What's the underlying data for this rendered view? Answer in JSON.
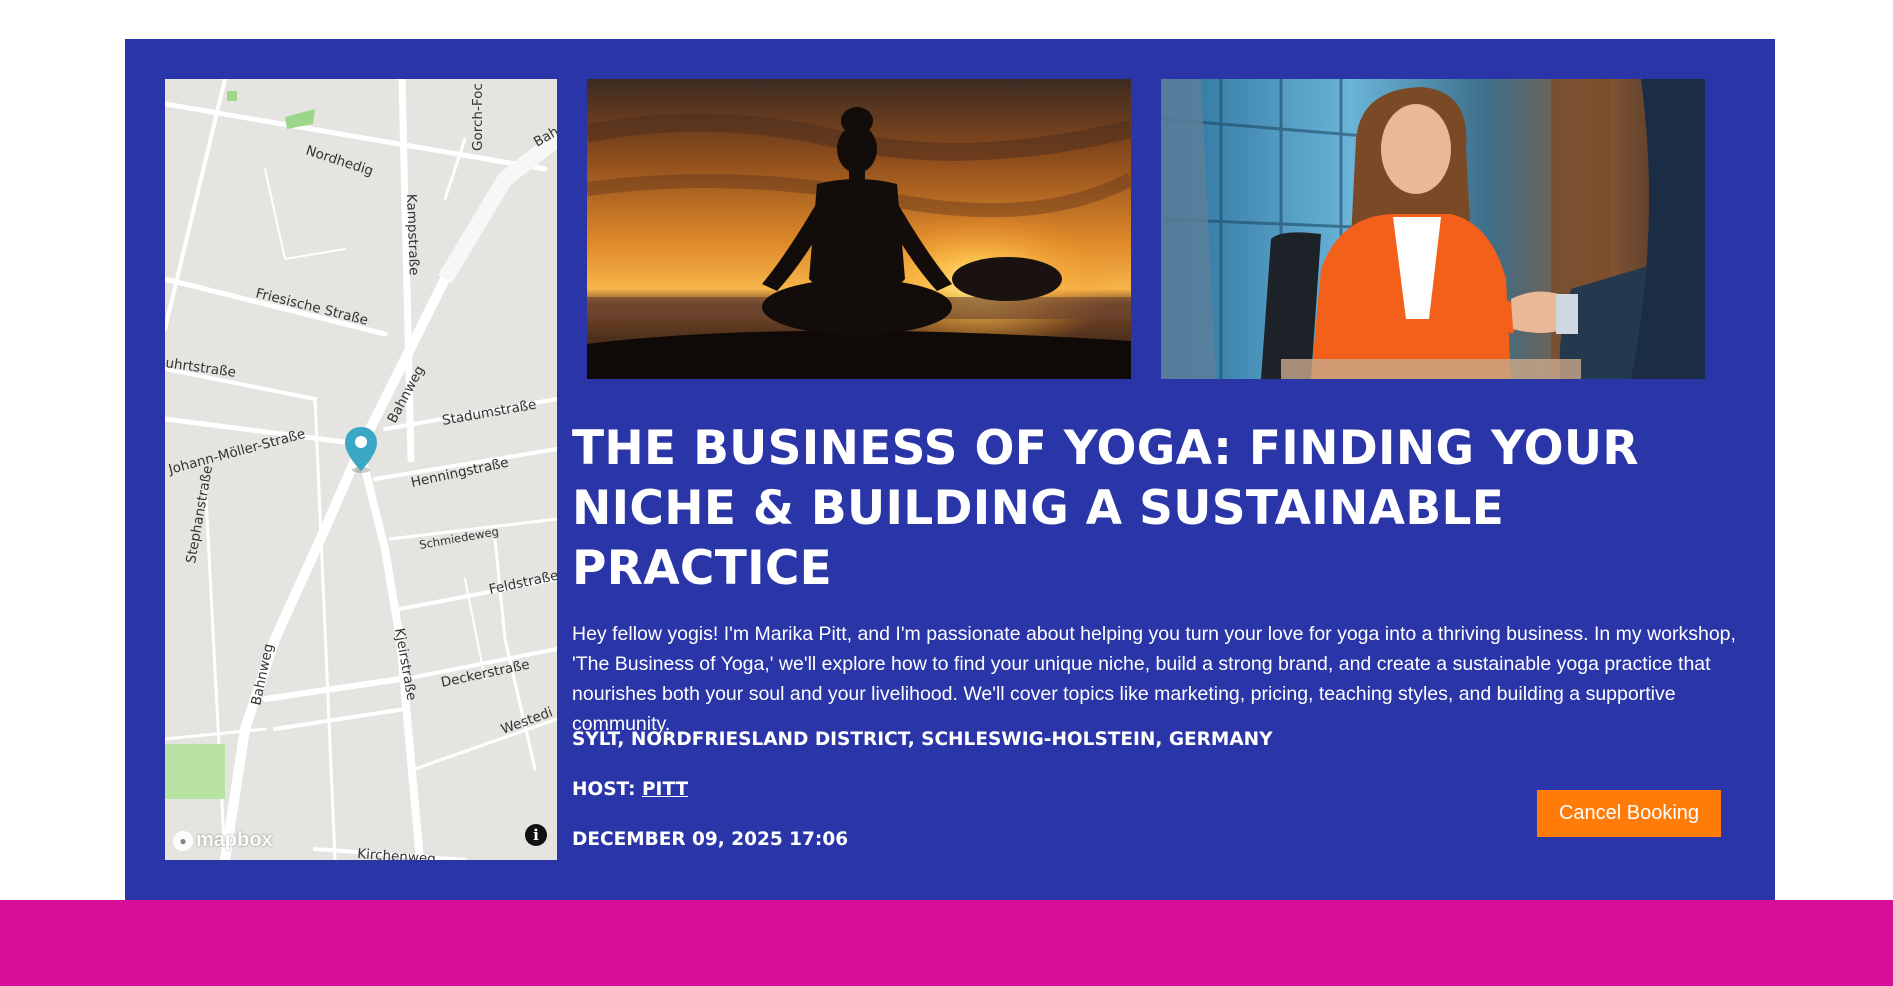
{
  "event": {
    "title": "The Business of Yoga: Finding Your Niche & Building a Sustainable Practice",
    "description": "Hey fellow yogis! I'm Marika Pitt, and I'm passionate about helping you turn your love for yoga into a thriving business. In my workshop, 'The Business of Yoga,' we'll explore how to find your unique niche, build a strong brand, and create a sustainable yoga practice that nourishes both your soul and your livelihood. We'll cover topics like marketing, pricing, teaching styles, and building a supportive community.",
    "location": "Sylt, Nordfriesland District, Schleswig-Holstein, Germany",
    "host_label": "Host:",
    "host_name": "Pitt",
    "datetime": "December 09, 2025 17:06",
    "cancel_label": "Cancel Booking"
  },
  "map": {
    "attribution": "mapbox",
    "streets": {
      "nordhedig": "Nordhedig",
      "gorch_fock": "Gorch-Foc",
      "bahnweg_top": "Bah",
      "kampstrasse": "Kampstraße",
      "friesische": "Friesische Straße",
      "uhrtstrasse": "uhrtstraße",
      "bahnweg_mid": "Bahnweg",
      "stadumstrasse": "Stadumstraße",
      "johann_moeller": "Johann-Möller-Straße",
      "henningstrasse": "Henningstraße",
      "stephanstrasse": "Stephanstraße",
      "schmiedeweg": "Schmiedeweg",
      "feldstrasse": "Feldstraße",
      "kjeirstrasse": "Kjeirstraße",
      "bahnweg_low": "Bahnweg",
      "deckerstrasse": "Deckerstraße",
      "westedi": "Westedi",
      "kirchenweg": "Kirchenweg"
    }
  },
  "colors": {
    "card": "#2a36a8",
    "footer": "#d60e98",
    "button": "#ff7b0a",
    "map_pin": "#3aa8c4"
  },
  "icons": {
    "marker": "map-pin-icon",
    "info": "info-icon",
    "logo": "mapbox-logo-icon"
  }
}
